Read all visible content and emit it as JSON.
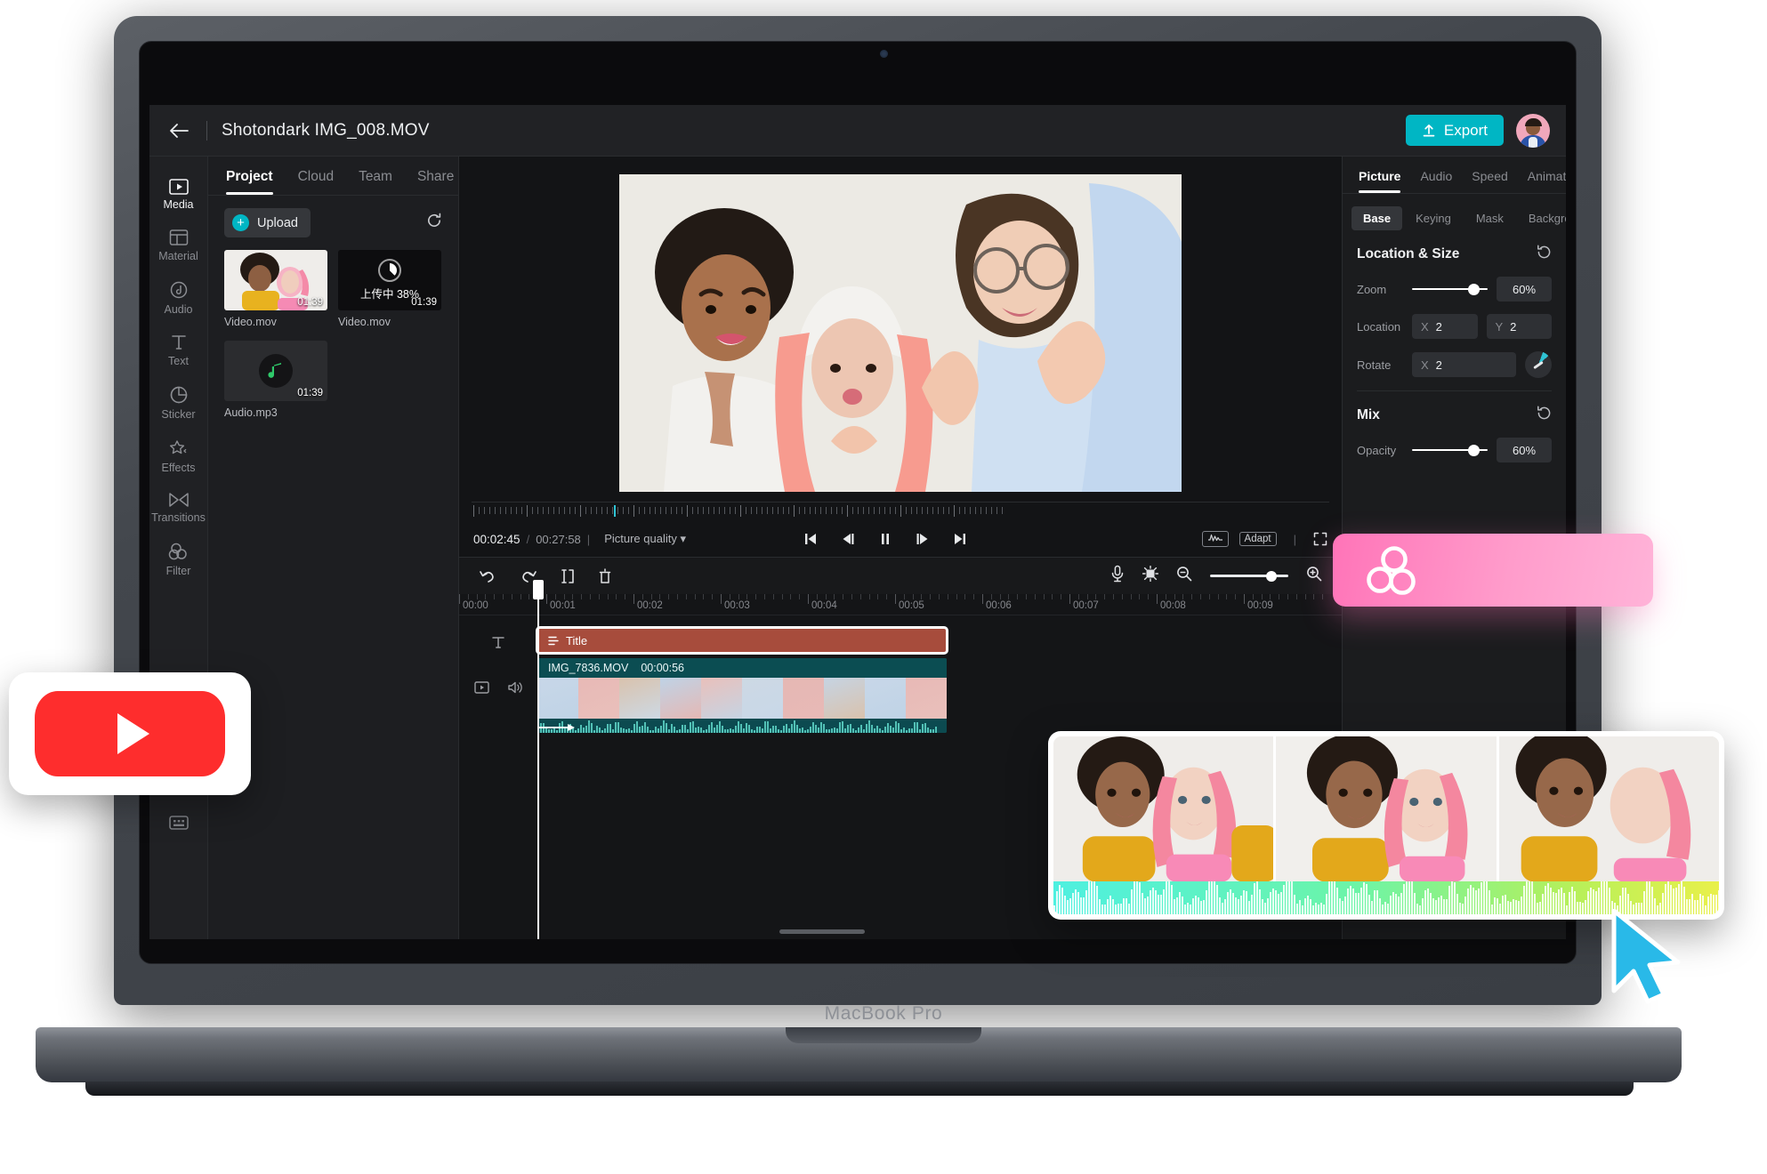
{
  "device": {
    "label": "MacBook Pro"
  },
  "header": {
    "back_icon": "back-arrow-icon",
    "project_title": "Shotondark IMG_008.MOV",
    "export_label": "Export",
    "export_icon": "upload-icon",
    "export_color": "#00b6c4",
    "avatar_name": "user-avatar"
  },
  "rail": {
    "items": [
      {
        "label": "Media",
        "icon": "media-icon",
        "active": true
      },
      {
        "label": "Material",
        "icon": "material-icon",
        "active": false
      },
      {
        "label": "Audio",
        "icon": "audio-icon",
        "active": false
      },
      {
        "label": "Text",
        "icon": "text-icon",
        "active": false
      },
      {
        "label": "Sticker",
        "icon": "sticker-icon",
        "active": false
      },
      {
        "label": "Effects",
        "icon": "effects-icon",
        "active": false
      },
      {
        "label": "Transitions",
        "icon": "transitions-icon",
        "active": false
      },
      {
        "label": "Filter",
        "icon": "filter-icon",
        "active": false
      }
    ],
    "bottom_icon": "keyboard-shortcuts-icon"
  },
  "panel": {
    "tabs": [
      {
        "label": "Project",
        "active": true
      },
      {
        "label": "Cloud",
        "active": false
      },
      {
        "label": "Team",
        "active": false
      },
      {
        "label": "Share",
        "active": false
      }
    ],
    "upload_label": "Upload",
    "refresh_icon": "refresh-icon",
    "media": [
      {
        "name": "Video.mov",
        "duration": "01:39",
        "state": "ready",
        "status_text": ""
      },
      {
        "name": "Video.mov",
        "duration": "01:39",
        "state": "uploading",
        "status_text": "上传中 38%",
        "progress": 38
      },
      {
        "name": "Audio.mp3",
        "duration": "01:39",
        "state": "audio",
        "status_text": ""
      }
    ]
  },
  "player": {
    "current_time": "00:02:45",
    "total_time": "00:27:58",
    "quality_label": "Picture quality",
    "controls": [
      {
        "name": "skip-to-start-button",
        "icon": "skip-start-icon"
      },
      {
        "name": "step-back-button",
        "icon": "step-back-icon"
      },
      {
        "name": "pause-button",
        "icon": "pause-icon"
      },
      {
        "name": "step-forward-button",
        "icon": "step-forward-icon"
      },
      {
        "name": "skip-to-end-button",
        "icon": "skip-end-icon"
      }
    ],
    "waveform_chip": "waveform-icon",
    "adapt_label": "Adapt",
    "fullscreen_icon": "fullscreen-icon"
  },
  "timeline": {
    "tools": [
      {
        "name": "undo-button",
        "icon": "undo-icon"
      },
      {
        "name": "redo-button",
        "icon": "redo-icon"
      },
      {
        "name": "split-button",
        "icon": "split-icon"
      },
      {
        "name": "delete-button",
        "icon": "trash-icon"
      }
    ],
    "right_tools": [
      {
        "name": "record-voiceover-button",
        "icon": "microphone-icon"
      },
      {
        "name": "fit-to-window-button",
        "icon": "fit-screen-icon"
      },
      {
        "name": "zoom-out-button",
        "icon": "zoom-out-icon"
      },
      {
        "name": "zoom-in-button",
        "icon": "zoom-in-icon"
      }
    ],
    "zoom_value": 72,
    "ruler_labels": [
      "00:00",
      "00:01",
      "00:02",
      "00:03",
      "00:04",
      "00:05",
      "00:06",
      "00:07",
      "00:08",
      "00:09"
    ],
    "title_clip": {
      "label": "Title",
      "icon": "text-clip-icon",
      "color": "#a74c3c"
    },
    "video_clip": {
      "name": "IMG_7836.MOV",
      "duration": "00:00:56",
      "color": "#0f5a5f"
    },
    "track_heads": [
      {
        "name": "text-track-head",
        "icon": "text-icon"
      },
      {
        "name": "video-track-head",
        "icon": "video-icon"
      },
      {
        "name": "audio-mute-head",
        "icon": "speaker-icon"
      }
    ]
  },
  "inspector": {
    "tabs": [
      {
        "label": "Picture",
        "active": true
      },
      {
        "label": "Audio",
        "active": false
      },
      {
        "label": "Speed",
        "active": false
      },
      {
        "label": "Animation",
        "active": false
      }
    ],
    "segments": [
      {
        "label": "Base",
        "active": true
      },
      {
        "label": "Keying",
        "active": false
      },
      {
        "label": "Mask",
        "active": false
      },
      {
        "label": "Background",
        "active": false
      }
    ],
    "location_size": {
      "title": "Location & Size",
      "reset_icon": "reset-icon",
      "zoom": {
        "label": "Zoom",
        "value": "60%",
        "percent": 74
      },
      "location": {
        "label": "Location",
        "x_axis": "X",
        "x_value": "2",
        "y_axis": "Y",
        "y_value": "2"
      },
      "rotate": {
        "label": "Rotate",
        "x_axis": "X",
        "x_value": "2",
        "knob_icon": "rotate-knob-icon"
      }
    },
    "mix": {
      "title": "Mix",
      "reset_icon": "reset-icon",
      "opacity": {
        "label": "Opacity",
        "value": "60%",
        "percent": 74
      }
    }
  },
  "overlays": {
    "pink_card": {
      "icon": "filter-bubbles-icon",
      "gradient_from": "#ff74b8",
      "gradient_to": "#ffb3d8"
    },
    "film_card": {
      "frames": 3,
      "waveform_from": "#4ef0e0",
      "waveform_to": "#e9f04a"
    },
    "youtube_badge": {
      "icon": "youtube-play-icon",
      "color": "#fe2d2d"
    }
  }
}
